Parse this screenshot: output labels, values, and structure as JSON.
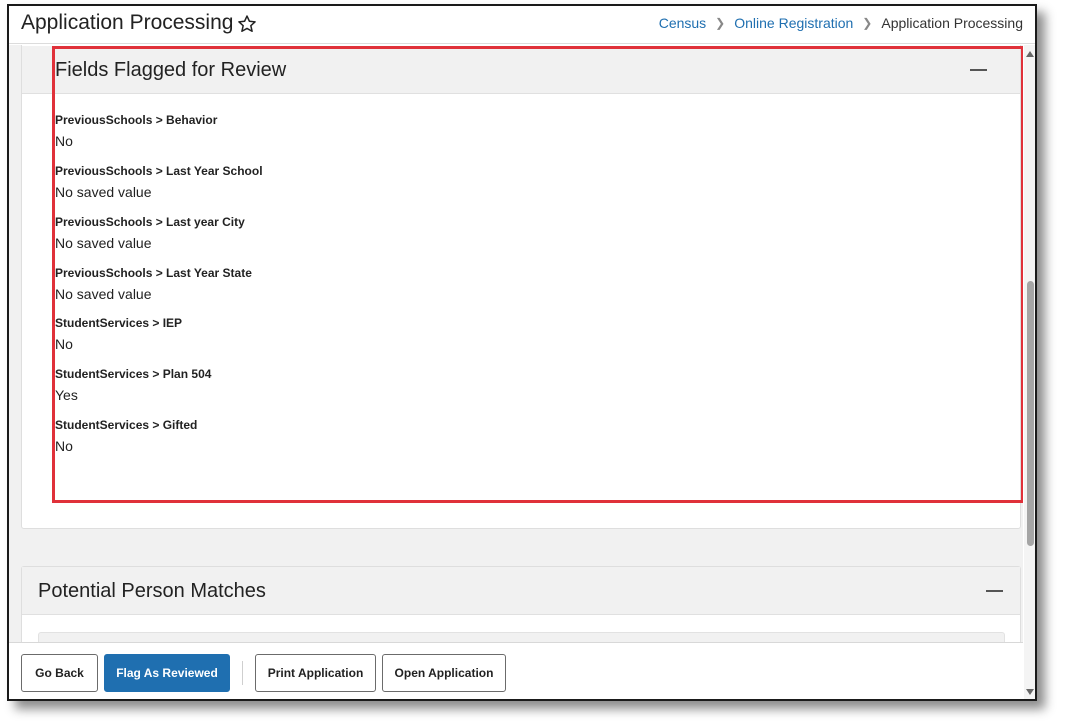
{
  "header": {
    "title": "Application Processing",
    "breadcrumb": [
      "Census",
      "Online Registration",
      "Application Processing"
    ]
  },
  "flagged_section": {
    "title": "Fields Flagged for Review",
    "fields": [
      {
        "label": "PreviousSchools > Behavior",
        "value": "No"
      },
      {
        "label": "PreviousSchools > Last Year School",
        "value": "No saved value"
      },
      {
        "label": "PreviousSchools > Last year City",
        "value": "No saved value"
      },
      {
        "label": "PreviousSchools > Last Year State",
        "value": "No saved value"
      },
      {
        "label": "StudentServices > IEP",
        "value": "No"
      },
      {
        "label": "StudentServices > Plan 504",
        "value": "Yes"
      },
      {
        "label": "StudentServices > Gifted",
        "value": "No"
      }
    ]
  },
  "matches_section": {
    "title": "Potential Person Matches"
  },
  "actions": {
    "go_back": "Go Back",
    "flag_reviewed": "Flag As Reviewed",
    "print_application": "Print Application",
    "open_application": "Open Application"
  },
  "colors": {
    "link": "#1f6fb0",
    "primary_button": "#1f6fb0",
    "highlight_border": "#e0313a"
  },
  "icons": {
    "favorite": "star-outline-icon",
    "collapse": "minus-icon",
    "breadcrumb_separator": "chevron-right-icon"
  }
}
